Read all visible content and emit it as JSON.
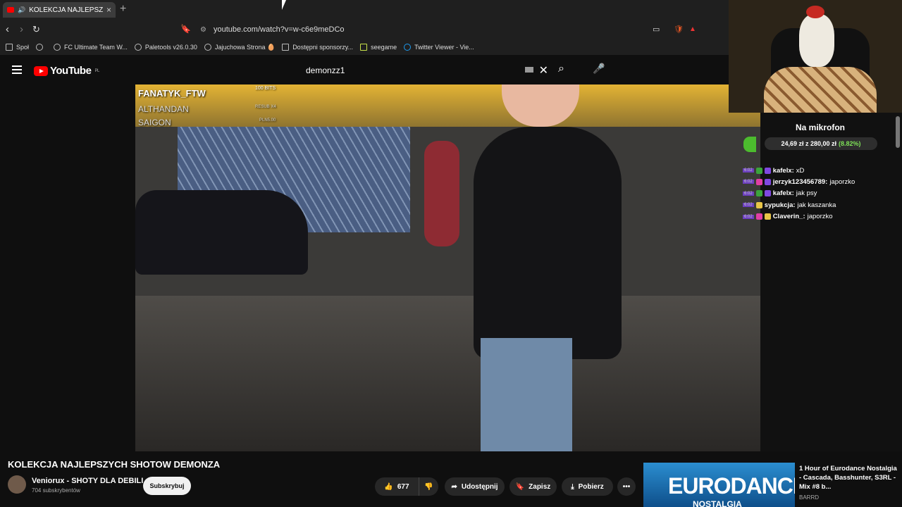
{
  "browser": {
    "tab_title": "KOLEKCJA NAJLEPSZYCH SHO",
    "tab_close": "×",
    "new_tab": "+",
    "url": "youtube.com/watch?v=w-c6e9meDCo",
    "bookmarks": [
      {
        "label": "Społ",
        "icon": "folder-icon"
      },
      {
        "label": "",
        "icon": "globe-icon"
      },
      {
        "label": "FC Ultimate Team W...",
        "icon": "globe-icon"
      },
      {
        "label": "Paletools v26.0.30",
        "icon": "globe-icon"
      },
      {
        "label": "Jajuchowa Strona 🥚",
        "icon": "globe-icon"
      },
      {
        "label": "Dostępni sponsorzy...",
        "icon": "globe-icon"
      },
      {
        "label": "seegame",
        "icon": "globe-icon"
      },
      {
        "label": "Twitter Viewer - Vie...",
        "icon": "globe-icon"
      }
    ]
  },
  "youtube": {
    "logo": "YouTube",
    "country": "PL",
    "search_value": "demonzz1"
  },
  "stream_overlay": {
    "name": "FANATYK_FTW",
    "bits": "100 BITS",
    "line2": "ALTHANDAN",
    "line2_tag": "RESUB X4",
    "line3": "SAIGON",
    "line3_tag": "PLN5.00"
  },
  "goal": {
    "title": "Na mikrofon",
    "amount": "24,69 zł z 280,00 zł",
    "percent": "(8.82%)",
    "fraction": 0.0882
  },
  "chat": [
    {
      "time": "6:02",
      "user": "kafelx",
      "msg": " xD",
      "color": "#ffffff",
      "badge1": "#3ba53b",
      "badge2": "#7f48e0"
    },
    {
      "time": "6:02",
      "user": "jerzyk123456789",
      "msg": " japorzko",
      "color": "#ffffff",
      "badge1": "#e03fa5",
      "badge2": "#7f48e0"
    },
    {
      "time": "6:02",
      "user": "kafelx",
      "msg": " jak psy",
      "color": "#ffffff",
      "badge1": "#3ba53b",
      "badge2": "#7f48e0"
    },
    {
      "time": "6:02",
      "user": "sypukcja",
      "msg": " jak kaszanka",
      "color": "#ffffff",
      "badge1": "#e8c547",
      "badge2": ""
    },
    {
      "time": "6:02",
      "user": "Claverin_",
      "msg": " japorzko",
      "color": "#ffffff",
      "badge1": "#e03fa5",
      "badge2": "#e8c547"
    }
  ],
  "video": {
    "title": "KOLEKCJA NAJLEPSZYCH SHOTOW DEMONZA",
    "channel": "Veniorux - SHOTY DLA DEBILI",
    "subscribers": "704 subskrybentów",
    "subscribe": "Subskrybuj",
    "likes": "677",
    "share": "Udostępnij",
    "save": "Zapisz",
    "download": "Pobierz"
  },
  "recommended": {
    "thumb_text": "EURODANCE",
    "thumb_sub": "NOSTALGIA",
    "title": "1 Hour of Eurodance Nostalgia - Cascada, Basshunter, S3RL - Mix #8 b...",
    "channel": "BARRD"
  }
}
